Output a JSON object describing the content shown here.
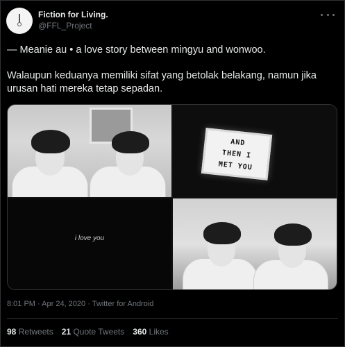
{
  "author": {
    "display_name": "Fiction for Living.",
    "handle": "@FFL_Project"
  },
  "tweet": {
    "line1": "— Meanie au • a love story between mingyu and wonwoo.",
    "line2": "Walaupun keduanya memiliki sifat yang betolak belakang, namun jika urusan hati mereka tetap sepadan."
  },
  "media": {
    "lightbox_lines": [
      "AND",
      "THEN I",
      "MET YOU"
    ],
    "caption_text": "i love you"
  },
  "meta": {
    "time": "8:01 PM",
    "separator": "·",
    "date": "Apr 24, 2020",
    "client": "Twitter for Android"
  },
  "stats": {
    "retweets_count": "98",
    "retweets_label": "Retweets",
    "quotes_count": "21",
    "quotes_label": "Quote Tweets",
    "likes_count": "360",
    "likes_label": "Likes"
  }
}
